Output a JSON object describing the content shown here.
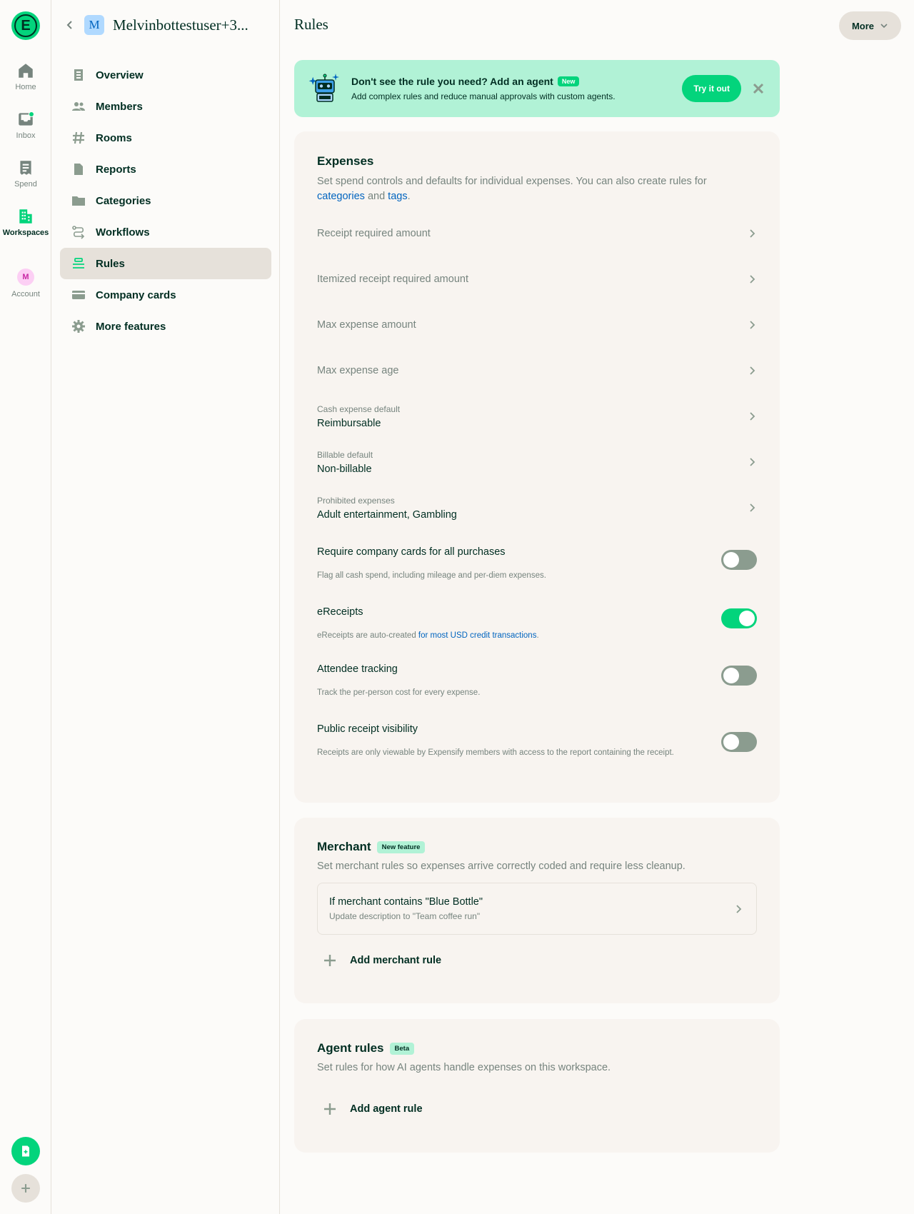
{
  "rail": {
    "logo_letter": "E",
    "items": [
      {
        "label": "Home",
        "icon": "home-icon"
      },
      {
        "label": "Inbox",
        "icon": "inbox-icon"
      },
      {
        "label": "Spend",
        "icon": "receipt-icon"
      },
      {
        "label": "Workspaces",
        "icon": "building-icon"
      },
      {
        "label": "Account",
        "icon": "avatar"
      }
    ],
    "account_initial": "M"
  },
  "sidebar": {
    "workspace_initial": "M",
    "workspace_name": "Melvinbottestuser+3...",
    "items": [
      {
        "label": "Overview",
        "icon": "document-icon"
      },
      {
        "label": "Members",
        "icon": "users-icon"
      },
      {
        "label": "Rooms",
        "icon": "hashtag-icon"
      },
      {
        "label": "Reports",
        "icon": "file-icon"
      },
      {
        "label": "Categories",
        "icon": "folder-icon"
      },
      {
        "label": "Workflows",
        "icon": "workflow-icon"
      },
      {
        "label": "Rules",
        "icon": "rules-icon"
      },
      {
        "label": "Company cards",
        "icon": "credit-card-icon"
      },
      {
        "label": "More features",
        "icon": "gear-icon"
      }
    ],
    "active": "Rules"
  },
  "header": {
    "title": "Rules",
    "more_label": "More"
  },
  "banner": {
    "title": "Don't see the rule you need? Add an agent",
    "badge": "New",
    "subtitle": "Add complex rules and reduce manual approvals with custom agents.",
    "cta": "Try it out"
  },
  "expenses": {
    "title": "Expenses",
    "desc_prefix": "Set spend controls and defaults for individual expenses. You can also create rules for",
    "link_categories": "categories",
    "and": "and",
    "link_tags": "tags",
    "period": ".",
    "rows": [
      {
        "label": "Receipt required amount"
      },
      {
        "label": "Itemized receipt required amount"
      },
      {
        "label": "Max expense amount"
      },
      {
        "label": "Max expense age"
      },
      {
        "label": "Cash expense default",
        "value": "Reimbursable"
      },
      {
        "label": "Billable default",
        "value": "Non-billable"
      },
      {
        "label": "Prohibited expenses",
        "value": "Adult entertainment, Gambling"
      }
    ],
    "toggles": [
      {
        "title": "Require company cards for all purchases",
        "subtitle": "Flag all cash spend, including mileage and per-diem expenses.",
        "on": false
      },
      {
        "title": "eReceipts",
        "subtitle_prefix": "eReceipts are auto-created",
        "subtitle_link": "for most USD credit transactions",
        "subtitle_suffix": ".",
        "on": true
      },
      {
        "title": "Attendee tracking",
        "subtitle": "Track the per-person cost for every expense.",
        "on": false
      },
      {
        "title": "Public receipt visibility",
        "subtitle": "Receipts are only viewable by Expensify members with access to the report containing the receipt.",
        "on": false
      }
    ]
  },
  "merchant": {
    "title": "Merchant",
    "badge": "New feature",
    "desc": "Set merchant rules so expenses arrive correctly coded and require less cleanup.",
    "rule_title": "If merchant contains \"Blue Bottle\"",
    "rule_sub": "Update description to \"Team coffee run\"",
    "add_label": "Add merchant rule"
  },
  "agent": {
    "title": "Agent rules",
    "badge": "Beta",
    "desc": "Set rules for how AI agents handle expenses on this workspace.",
    "add_label": "Add agent rule"
  },
  "colors": {
    "accent": "#03D47C",
    "text": "#002E22",
    "muted": "#76847E",
    "link": "#0164BF",
    "banner_bg": "#B1F2D6",
    "card_bg": "#F8F4F0"
  }
}
